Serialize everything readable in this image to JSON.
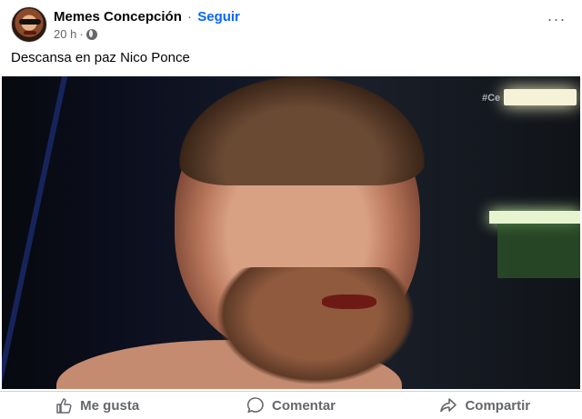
{
  "post": {
    "page_name": "Memes Concepción",
    "separator": "·",
    "follow_label": "Seguir",
    "time": "20 h",
    "time_separator": "·",
    "caption": "Descansa en paz Nico Ponce",
    "more_icon": "ellipsis-icon",
    "audience_icon": "globe-icon"
  },
  "photo": {
    "watermark": "#Ce"
  },
  "actions": {
    "like_label": "Me gusta",
    "comment_label": "Comentar",
    "share_label": "Compartir"
  },
  "colors": {
    "follow": "#0866ff",
    "secondary_text": "#65676b",
    "primary_text": "#050505",
    "divider": "#ced0d4"
  }
}
